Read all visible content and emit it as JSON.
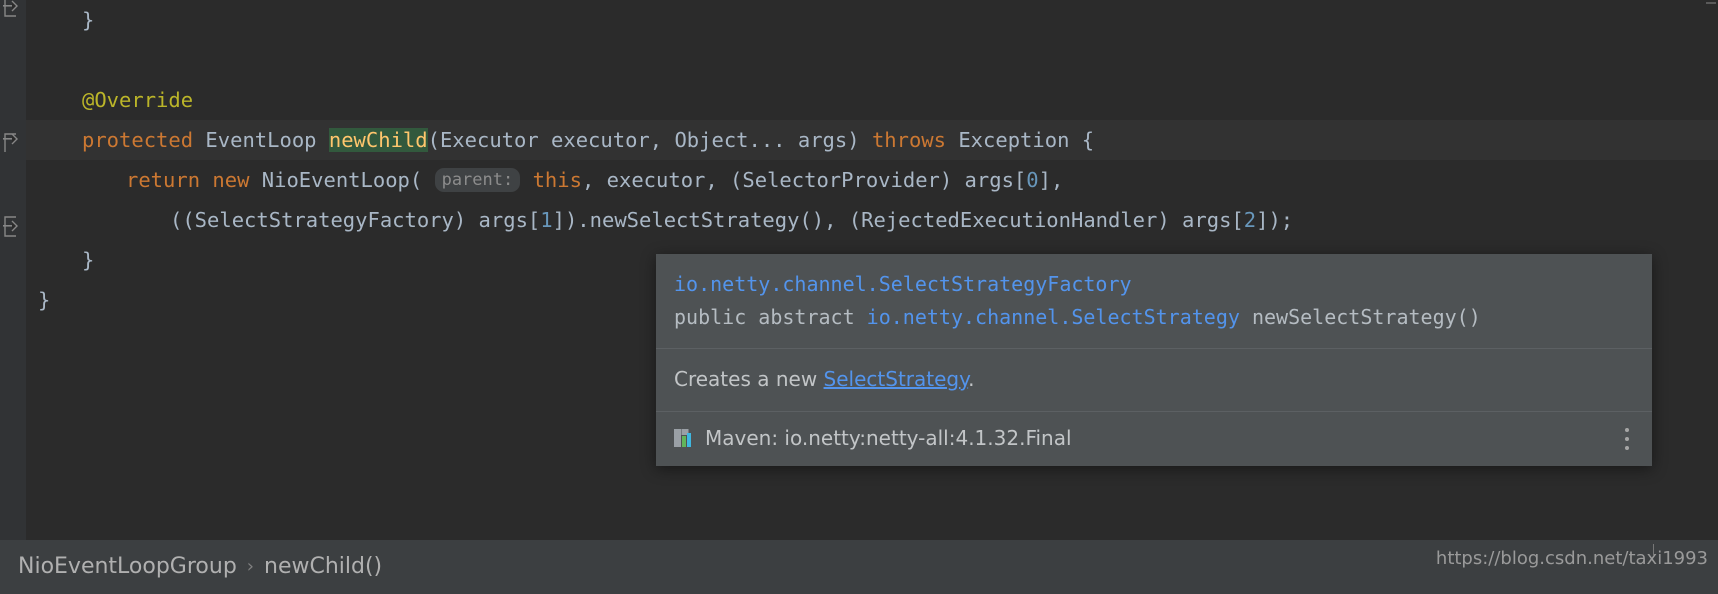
{
  "editor": {
    "lines": [
      {
        "indent": 2,
        "tokens": [
          {
            "t": "}",
            "c": "plain"
          }
        ]
      },
      {
        "indent": 0,
        "tokens": []
      },
      {
        "indent": 2,
        "tokens": [
          {
            "t": "@Override",
            "c": "ann"
          }
        ],
        "bulb": true
      },
      {
        "indent": 2,
        "highlight": true,
        "tokens": [
          {
            "t": "protected",
            "c": "kw"
          },
          {
            "t": " EventLoop ",
            "c": "plain"
          },
          {
            "t": "newChild",
            "c": "mth-hl"
          },
          {
            "t": "(Executor executor, Object... args) ",
            "c": "plain"
          },
          {
            "t": "throws",
            "c": "kw"
          },
          {
            "t": " Exception {",
            "c": "plain"
          }
        ]
      },
      {
        "indent": 4,
        "tokens": [
          {
            "t": "return",
            "c": "kw"
          },
          {
            "t": " ",
            "c": "plain"
          },
          {
            "t": "new",
            "c": "kw"
          },
          {
            "t": " NioEventLoop( ",
            "c": "plain"
          },
          {
            "t": "parent:",
            "c": "hint"
          },
          {
            "t": " ",
            "c": "plain"
          },
          {
            "t": "this",
            "c": "kw"
          },
          {
            "t": ", executor, (SelectorProvider) args[",
            "c": "plain"
          },
          {
            "t": "0",
            "c": "num"
          },
          {
            "t": "],",
            "c": "plain"
          }
        ]
      },
      {
        "indent": 6,
        "tokens": [
          {
            "t": "((SelectStrategyFactory) args[",
            "c": "plain"
          },
          {
            "t": "1",
            "c": "num"
          },
          {
            "t": "]).newSelectStrategy(), (RejectedExecutionHandler) args[",
            "c": "plain"
          },
          {
            "t": "2",
            "c": "num"
          },
          {
            "t": "]);",
            "c": "plain"
          }
        ]
      },
      {
        "indent": 2,
        "tokens": [
          {
            "t": "}",
            "c": "plain"
          }
        ]
      },
      {
        "indent": 0,
        "tokens": [
          {
            "t": "}",
            "c": "plain"
          }
        ]
      }
    ]
  },
  "doc_popup": {
    "header": {
      "qualified_type": "io.netty.channel.SelectStrategyFactory",
      "signature_modifiers": "public abstract ",
      "signature_return_type": "io.netty.channel.SelectStrategy",
      "signature_method": " newSelectStrategy()"
    },
    "body": {
      "text_before": "Creates a new ",
      "link": "SelectStrategy",
      "text_after": "."
    },
    "footer": {
      "icon": "maven-icon",
      "label": "Maven: io.netty:netty-all:4.1.32.Final",
      "menu_icon": "kebab-menu-icon"
    }
  },
  "breadcrumb": {
    "items": [
      "NioEventLoopGroup",
      "newChild()"
    ],
    "separator": "›"
  },
  "watermark": "https://blog.csdn.net/taxi1993",
  "colors": {
    "editor_bg": "#2b2b2b",
    "gutter_bg": "#313335",
    "popup_bg": "#4e5254",
    "bottom_bar_bg": "#3c3f41",
    "keyword": "#cc7832",
    "annotation": "#bbb529",
    "method": "#ffc66d",
    "number": "#6897bb",
    "link": "#5394ec",
    "default_text": "#a9b7c6",
    "search_highlight": "#32593d"
  }
}
